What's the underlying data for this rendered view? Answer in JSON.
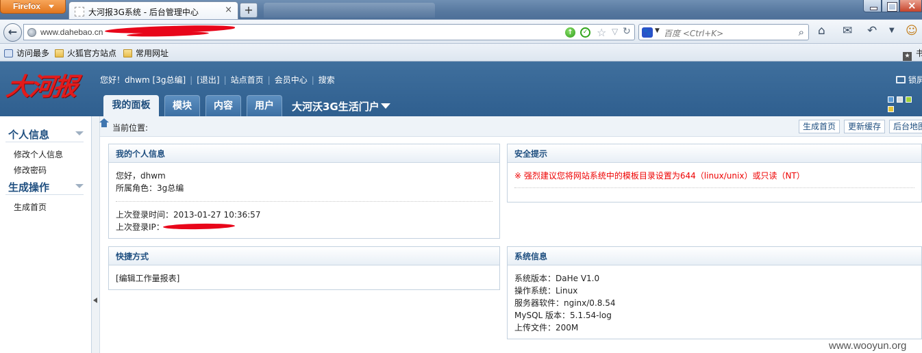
{
  "browser": {
    "menu_button": "Firefox",
    "tab_title": "大河报3G系统 - 后台管理中心",
    "new_tab": "+",
    "url": "www.dahebao.cn",
    "search_placeholder": "百度 <Ctrl+K>",
    "bookmarks": [
      "访问最多",
      "火狐官方站点",
      "常用网址"
    ],
    "bookmarks_right": "书"
  },
  "header": {
    "logo_text": "大河报",
    "greeting": "您好！dhwm [3g总编]",
    "links": [
      "[退出]",
      "站点首页",
      "会员中心",
      "搜索"
    ],
    "lock_label": "锁屏",
    "tabs": [
      "我的面板",
      "模块",
      "内容",
      "用户"
    ],
    "portal": "大河沃3G生活门户",
    "skin_colors": [
      "#5a9ad6",
      "#d7dde3",
      "#9fd13a",
      "#e3c43a"
    ]
  },
  "sidebar": {
    "groups": [
      {
        "title": "个人信息",
        "items": [
          "修改个人信息",
          "修改密码"
        ]
      },
      {
        "title": "生成操作",
        "items": [
          "生成首页"
        ]
      }
    ]
  },
  "breadcrumb": {
    "label": "当前位置:",
    "buttons": [
      "生成首页",
      "更新缓存",
      "后台地图"
    ]
  },
  "panels": {
    "profile": {
      "title": "我的个人信息",
      "hello": "您好，dhwm",
      "role": "所属角色：3g总编",
      "last_login_time": "上次登录时间：2013-01-27 10:36:57",
      "last_login_ip": "上次登录IP："
    },
    "security": {
      "title": "安全提示",
      "message": "※ 强烈建议您将网站系统中的模板目录设置为644（linux/unix）或只读（NT）"
    },
    "shortcuts": {
      "title": "快捷方式",
      "link": "[编辑工作量报表]"
    },
    "sysinfo": {
      "title": "系统信息",
      "lines": [
        "系统版本：DaHe V1.0",
        "操作系统：Linux",
        "服务器软件：nginx/0.8.54",
        "MySQL 版本：5.1.54-log",
        "上传文件：200M"
      ]
    }
  },
  "watermark": "www.wooyun.org"
}
